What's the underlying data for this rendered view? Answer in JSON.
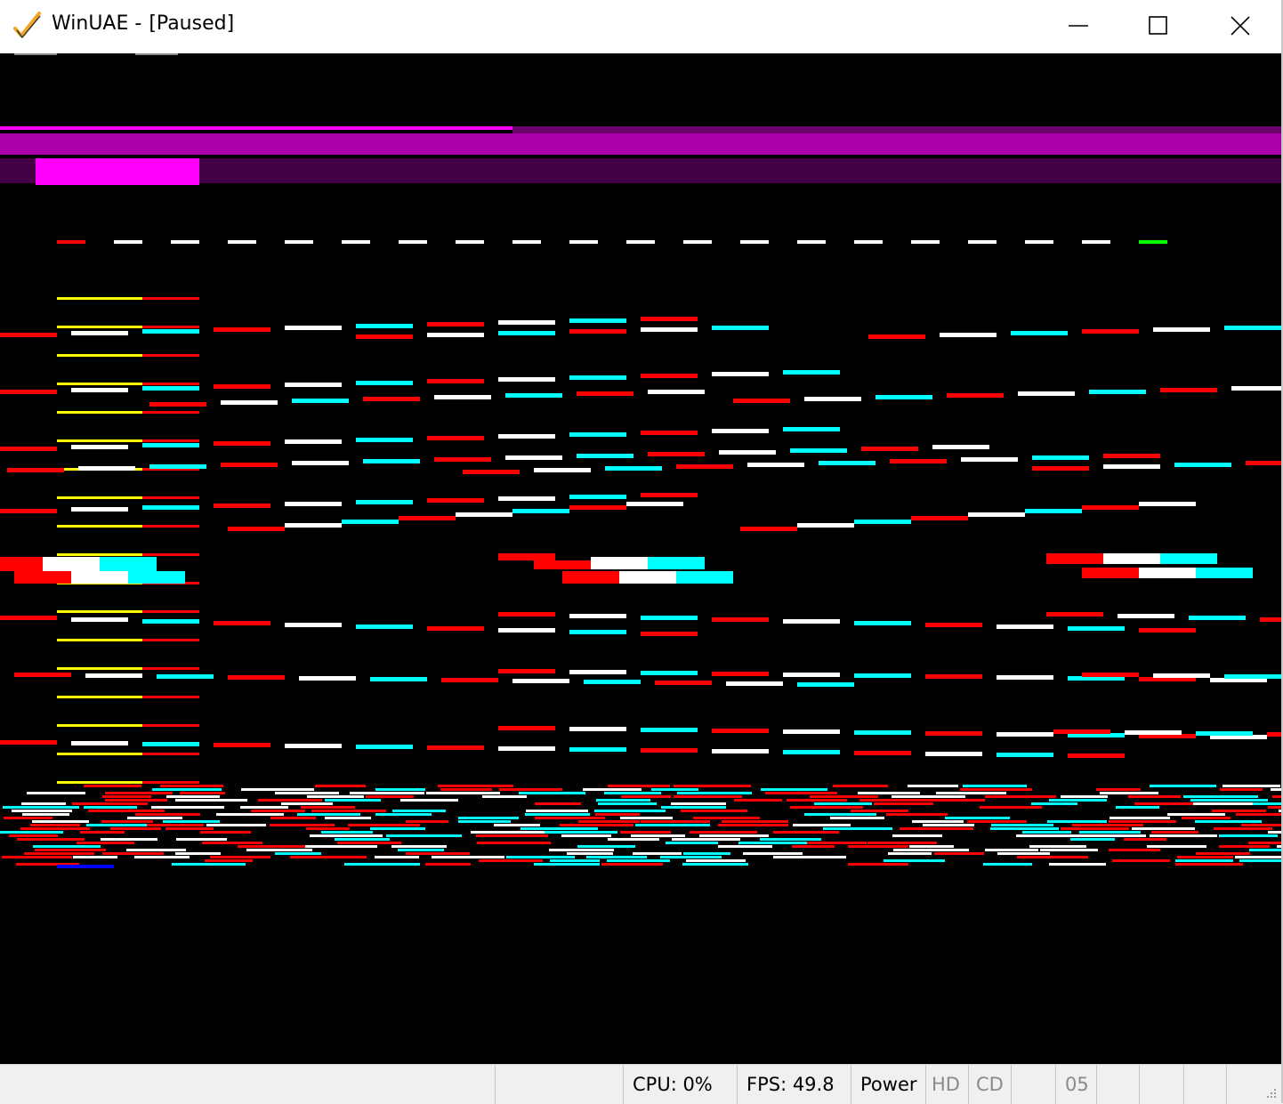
{
  "window": {
    "app_name": "WinUAE",
    "separator": "-",
    "state": "[Paused]",
    "controls": {
      "minimize_icon": "minimize-icon",
      "maximize_icon": "maximize-icon",
      "close_icon": "close-icon"
    }
  },
  "emulator_screen": {
    "background": "#000000",
    "palette": {
      "magenta": "#ff00ff",
      "purple": "#aa00aa",
      "dark_purple": "#440044",
      "red": "#ff0000",
      "white": "#ffffff",
      "cyan": "#00ffff",
      "yellow": "#ffff00",
      "green": "#00ff00",
      "blue": "#0000ff"
    }
  },
  "statusbar": {
    "cpu": "CPU: 0%",
    "fps": "FPS: 49.8",
    "power": "Power",
    "hd": "HD",
    "cd": "CD",
    "drive": "05"
  }
}
